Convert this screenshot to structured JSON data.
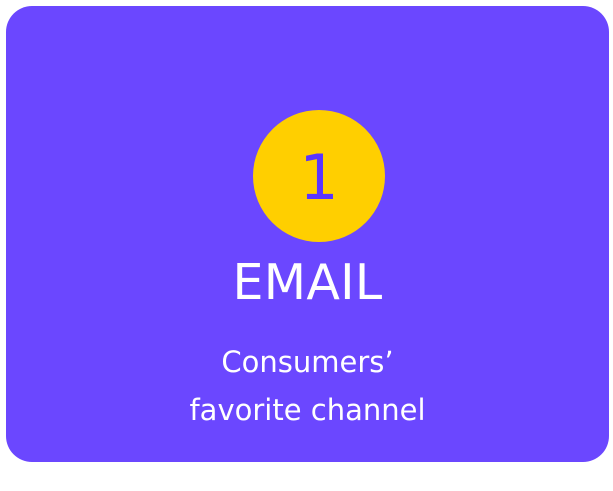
{
  "card": {
    "number": "1",
    "title": "EMAIL",
    "subtitle_lines": [
      "Consumers’",
      "favorite channel"
    ]
  },
  "colors": {
    "card_background": "#6b47ff",
    "badge_background": "#ffcf00",
    "badge_text": "#5a35ff",
    "text": "#ffffff",
    "page_background": "#ffffff"
  }
}
